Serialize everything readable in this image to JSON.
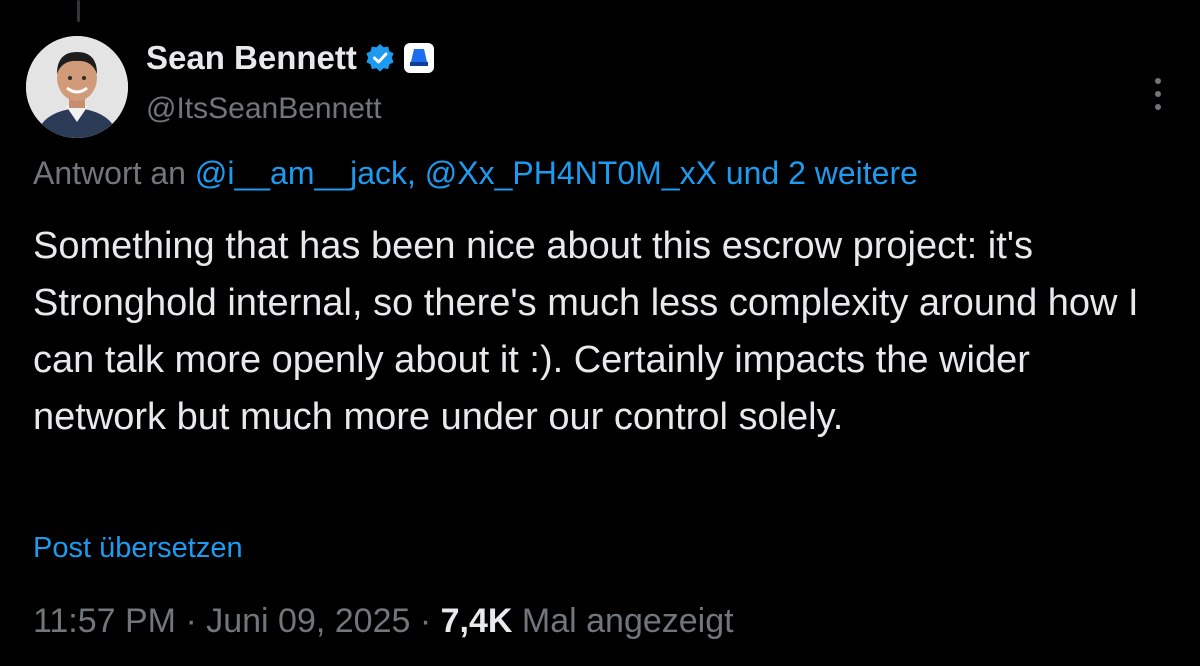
{
  "author": {
    "display_name": "Sean Bennett",
    "handle": "@ItsSeanBennett",
    "verified_icon": "verified-badge-icon",
    "affiliate_icon": "affiliate-badge-icon",
    "avatar": "profile-photo"
  },
  "menu": {
    "icon": "more-options-icon"
  },
  "reply_context": {
    "prefix": "Antwort an ",
    "mentions": "@i__am__jack, @Xx_PH4NT0M_xX",
    "suffix": " und 2 weitere"
  },
  "post": {
    "text": "Something that has been nice about this escrow project: it's Stronghold internal, so there's much less complexity around how I can talk more openly about it :). Certainly impacts the wider network but much more under our control solely."
  },
  "translate": {
    "label": "Post übersetzen"
  },
  "meta": {
    "time": "11:57 PM",
    "separator": " · ",
    "date": "Juni 09, 2025",
    "views_count": "7,4K",
    "views_label": " Mal angezeigt"
  },
  "colors": {
    "background": "#000000",
    "text_primary": "#e7e9ea",
    "text_secondary": "#71767b",
    "accent": "#1d9bf0"
  }
}
